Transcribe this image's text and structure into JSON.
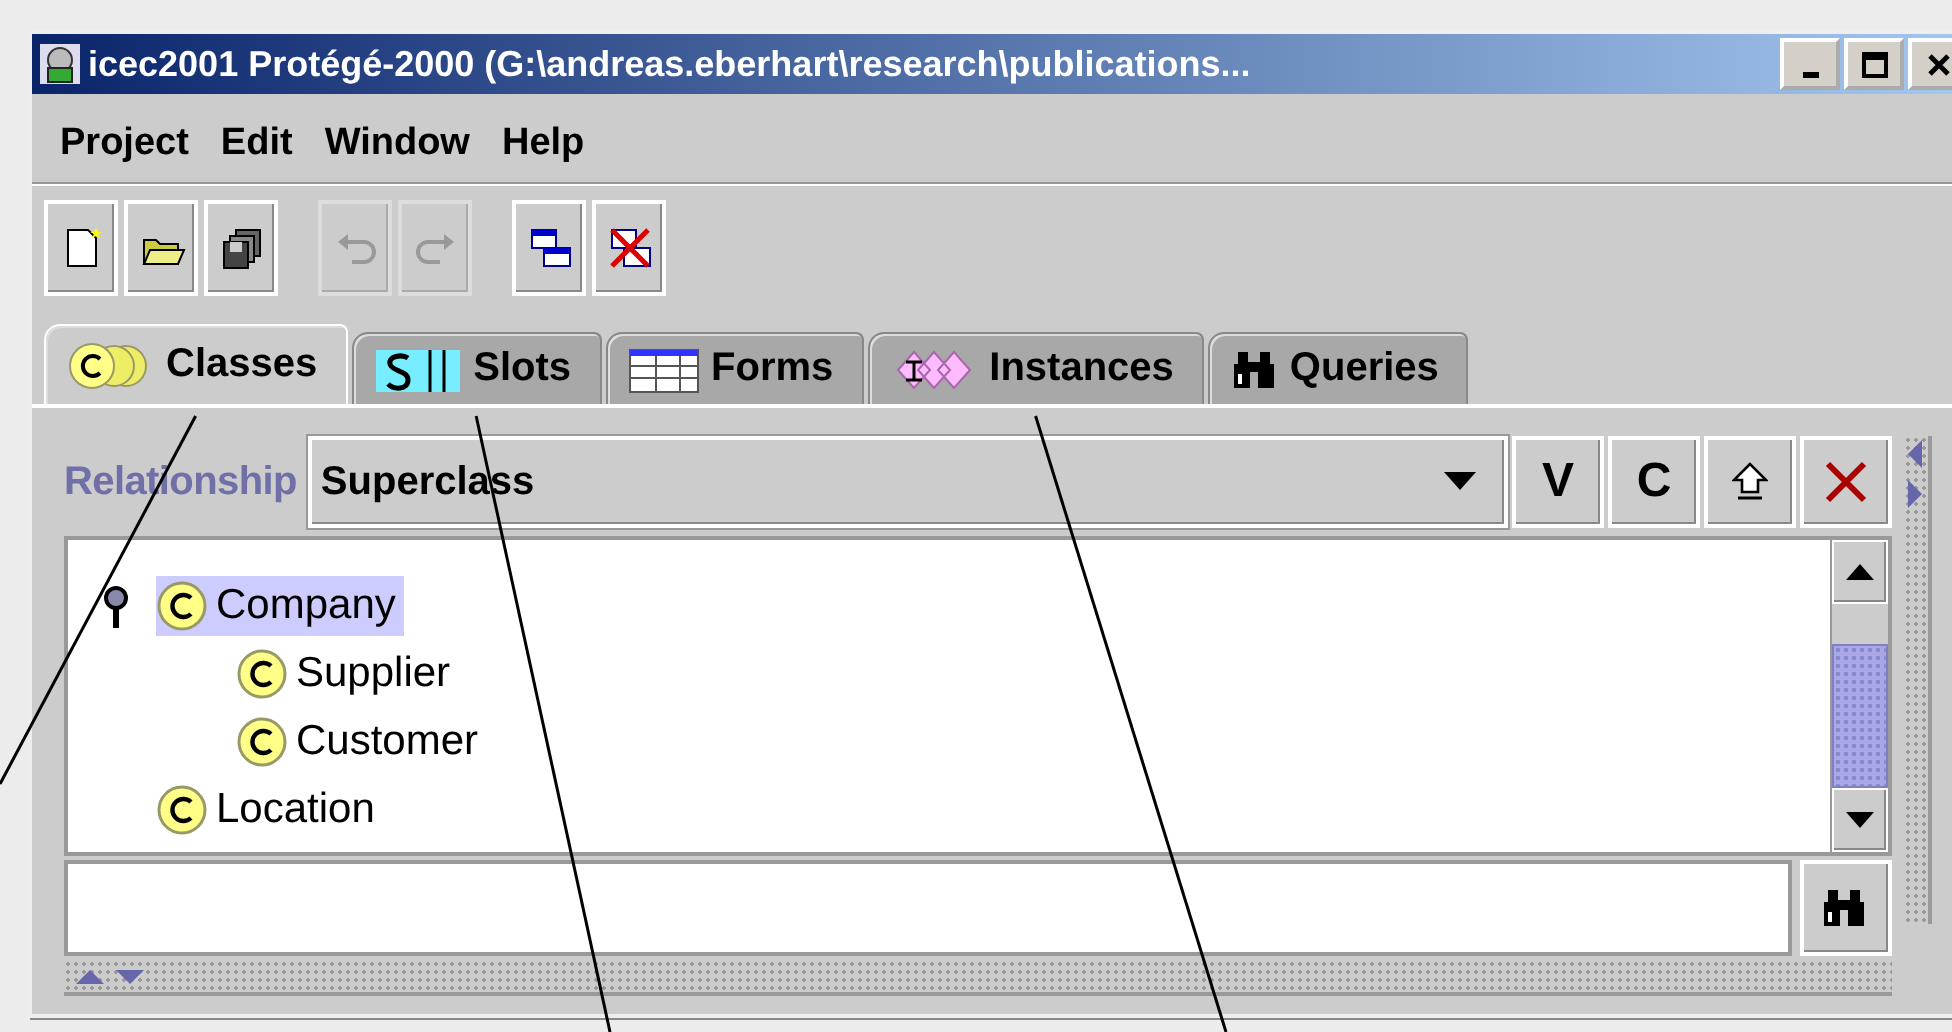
{
  "window": {
    "title": "icec2001  Protégé-2000    (G:\\andreas.eberhart\\research\\publications..."
  },
  "menu": [
    "Project",
    "Edit",
    "Window",
    "Help"
  ],
  "toolbar": [
    [
      {
        "kind": "new",
        "disabled": false
      },
      {
        "kind": "open",
        "disabled": false
      },
      {
        "kind": "save",
        "disabled": false
      }
    ],
    [
      {
        "kind": "undo",
        "disabled": true
      },
      {
        "kind": "redo",
        "disabled": true
      }
    ],
    [
      {
        "kind": "cascade",
        "disabled": false
      },
      {
        "kind": "close-all",
        "disabled": false
      }
    ]
  ],
  "tabs": [
    {
      "label": "Classes",
      "kind": "classes",
      "selected": true,
      "callout": true
    },
    {
      "label": "Slots",
      "kind": "slots",
      "selected": false,
      "callout": true
    },
    {
      "label": "Forms",
      "kind": "forms",
      "selected": false,
      "callout": false
    },
    {
      "label": "Instances",
      "kind": "instances",
      "selected": false,
      "callout": true
    },
    {
      "label": "Queries",
      "kind": "queries",
      "selected": false,
      "callout": false
    }
  ],
  "relationship": {
    "label": "Relationship",
    "value": "Superclass"
  },
  "class_buttons": [
    {
      "kind": "text",
      "label": "V"
    },
    {
      "kind": "text",
      "label": "C"
    },
    {
      "kind": "up"
    },
    {
      "kind": "delete"
    }
  ],
  "tree": [
    {
      "label": "Company",
      "selected": true,
      "expanded": true,
      "children": [
        {
          "label": "Supplier",
          "selected": false
        },
        {
          "label": "Customer",
          "selected": false
        }
      ]
    },
    {
      "label": "Location",
      "selected": false
    }
  ]
}
